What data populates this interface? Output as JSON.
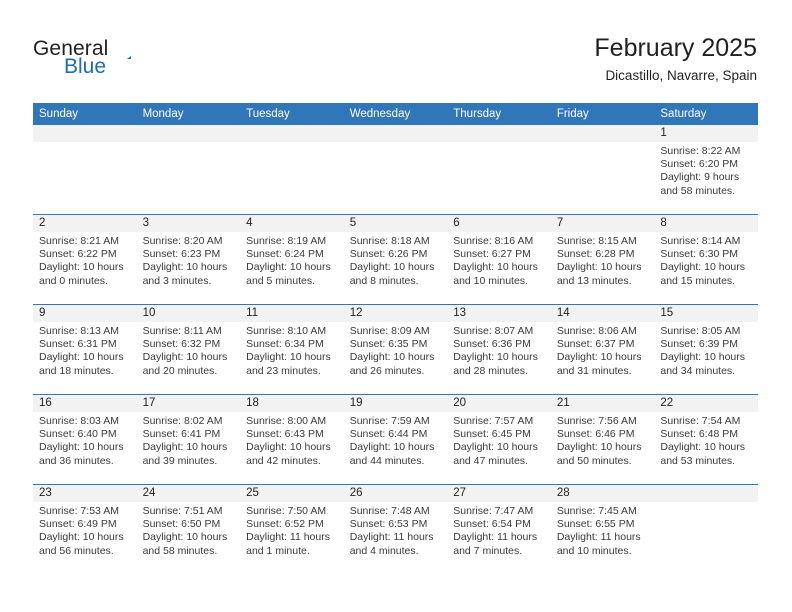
{
  "brand": {
    "name_top": "General",
    "name_bottom": "Blue",
    "accent_color": "#1f6cb0",
    "logo_icon": "triangle-flag-icon"
  },
  "header": {
    "title": "February 2025",
    "subtitle": "Dicastillo, Navarre, Spain"
  },
  "theme": {
    "header_row_bg": "#3176b9",
    "daynum_band_bg": "#f2f2f2",
    "row_divider": "#3176b9",
    "text": "#231f20"
  },
  "weekdays": [
    "Sunday",
    "Monday",
    "Tuesday",
    "Wednesday",
    "Thursday",
    "Friday",
    "Saturday"
  ],
  "weeks": [
    [
      {
        "day": "",
        "lines": []
      },
      {
        "day": "",
        "lines": []
      },
      {
        "day": "",
        "lines": []
      },
      {
        "day": "",
        "lines": []
      },
      {
        "day": "",
        "lines": []
      },
      {
        "day": "",
        "lines": []
      },
      {
        "day": "1",
        "lines": [
          "Sunrise: 8:22 AM",
          "Sunset: 6:20 PM",
          "Daylight: 9 hours",
          "and 58 minutes."
        ]
      }
    ],
    [
      {
        "day": "2",
        "lines": [
          "Sunrise: 8:21 AM",
          "Sunset: 6:22 PM",
          "Daylight: 10 hours",
          "and 0 minutes."
        ]
      },
      {
        "day": "3",
        "lines": [
          "Sunrise: 8:20 AM",
          "Sunset: 6:23 PM",
          "Daylight: 10 hours",
          "and 3 minutes."
        ]
      },
      {
        "day": "4",
        "lines": [
          "Sunrise: 8:19 AM",
          "Sunset: 6:24 PM",
          "Daylight: 10 hours",
          "and 5 minutes."
        ]
      },
      {
        "day": "5",
        "lines": [
          "Sunrise: 8:18 AM",
          "Sunset: 6:26 PM",
          "Daylight: 10 hours",
          "and 8 minutes."
        ]
      },
      {
        "day": "6",
        "lines": [
          "Sunrise: 8:16 AM",
          "Sunset: 6:27 PM",
          "Daylight: 10 hours",
          "and 10 minutes."
        ]
      },
      {
        "day": "7",
        "lines": [
          "Sunrise: 8:15 AM",
          "Sunset: 6:28 PM",
          "Daylight: 10 hours",
          "and 13 minutes."
        ]
      },
      {
        "day": "8",
        "lines": [
          "Sunrise: 8:14 AM",
          "Sunset: 6:30 PM",
          "Daylight: 10 hours",
          "and 15 minutes."
        ]
      }
    ],
    [
      {
        "day": "9",
        "lines": [
          "Sunrise: 8:13 AM",
          "Sunset: 6:31 PM",
          "Daylight: 10 hours",
          "and 18 minutes."
        ]
      },
      {
        "day": "10",
        "lines": [
          "Sunrise: 8:11 AM",
          "Sunset: 6:32 PM",
          "Daylight: 10 hours",
          "and 20 minutes."
        ]
      },
      {
        "day": "11",
        "lines": [
          "Sunrise: 8:10 AM",
          "Sunset: 6:34 PM",
          "Daylight: 10 hours",
          "and 23 minutes."
        ]
      },
      {
        "day": "12",
        "lines": [
          "Sunrise: 8:09 AM",
          "Sunset: 6:35 PM",
          "Daylight: 10 hours",
          "and 26 minutes."
        ]
      },
      {
        "day": "13",
        "lines": [
          "Sunrise: 8:07 AM",
          "Sunset: 6:36 PM",
          "Daylight: 10 hours",
          "and 28 minutes."
        ]
      },
      {
        "day": "14",
        "lines": [
          "Sunrise: 8:06 AM",
          "Sunset: 6:37 PM",
          "Daylight: 10 hours",
          "and 31 minutes."
        ]
      },
      {
        "day": "15",
        "lines": [
          "Sunrise: 8:05 AM",
          "Sunset: 6:39 PM",
          "Daylight: 10 hours",
          "and 34 minutes."
        ]
      }
    ],
    [
      {
        "day": "16",
        "lines": [
          "Sunrise: 8:03 AM",
          "Sunset: 6:40 PM",
          "Daylight: 10 hours",
          "and 36 minutes."
        ]
      },
      {
        "day": "17",
        "lines": [
          "Sunrise: 8:02 AM",
          "Sunset: 6:41 PM",
          "Daylight: 10 hours",
          "and 39 minutes."
        ]
      },
      {
        "day": "18",
        "lines": [
          "Sunrise: 8:00 AM",
          "Sunset: 6:43 PM",
          "Daylight: 10 hours",
          "and 42 minutes."
        ]
      },
      {
        "day": "19",
        "lines": [
          "Sunrise: 7:59 AM",
          "Sunset: 6:44 PM",
          "Daylight: 10 hours",
          "and 44 minutes."
        ]
      },
      {
        "day": "20",
        "lines": [
          "Sunrise: 7:57 AM",
          "Sunset: 6:45 PM",
          "Daylight: 10 hours",
          "and 47 minutes."
        ]
      },
      {
        "day": "21",
        "lines": [
          "Sunrise: 7:56 AM",
          "Sunset: 6:46 PM",
          "Daylight: 10 hours",
          "and 50 minutes."
        ]
      },
      {
        "day": "22",
        "lines": [
          "Sunrise: 7:54 AM",
          "Sunset: 6:48 PM",
          "Daylight: 10 hours",
          "and 53 minutes."
        ]
      }
    ],
    [
      {
        "day": "23",
        "lines": [
          "Sunrise: 7:53 AM",
          "Sunset: 6:49 PM",
          "Daylight: 10 hours",
          "and 56 minutes."
        ]
      },
      {
        "day": "24",
        "lines": [
          "Sunrise: 7:51 AM",
          "Sunset: 6:50 PM",
          "Daylight: 10 hours",
          "and 58 minutes."
        ]
      },
      {
        "day": "25",
        "lines": [
          "Sunrise: 7:50 AM",
          "Sunset: 6:52 PM",
          "Daylight: 11 hours",
          "and 1 minute."
        ]
      },
      {
        "day": "26",
        "lines": [
          "Sunrise: 7:48 AM",
          "Sunset: 6:53 PM",
          "Daylight: 11 hours",
          "and 4 minutes."
        ]
      },
      {
        "day": "27",
        "lines": [
          "Sunrise: 7:47 AM",
          "Sunset: 6:54 PM",
          "Daylight: 11 hours",
          "and 7 minutes."
        ]
      },
      {
        "day": "28",
        "lines": [
          "Sunrise: 7:45 AM",
          "Sunset: 6:55 PM",
          "Daylight: 11 hours",
          "and 10 minutes."
        ]
      },
      {
        "day": "",
        "lines": []
      }
    ]
  ]
}
